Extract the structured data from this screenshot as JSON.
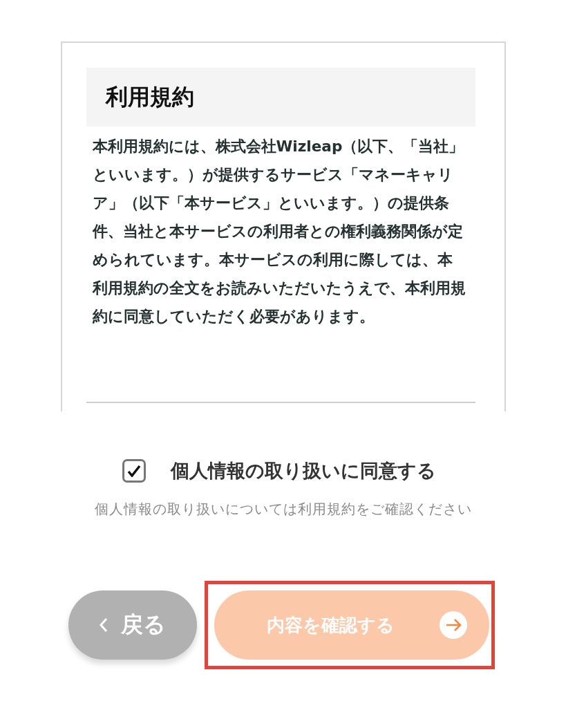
{
  "terms": {
    "title": "利用規約",
    "body": "本利用規約には、株式会社Wizleap（以下、「当社」といいます。）が提供するサービス「マネーキャリア」（以下「本サービス」といいます。）の提供条件、当社と本サービスの利用者との権利義務関係が定められています。本サービスの利用に際しては、本利用規約の全文をお読みいただいたうえで、本利用規約に同意していただく必要があります。"
  },
  "consent": {
    "label": "個人情報の取り扱いに同意する",
    "checked": true
  },
  "note": "個人情報の取り扱いについては利用規約をご確認ください",
  "buttons": [
    {
      "kind": "back",
      "label": "戻る"
    },
    {
      "kind": "next",
      "label": "内容を確認する",
      "highlighted": true
    }
  ]
}
